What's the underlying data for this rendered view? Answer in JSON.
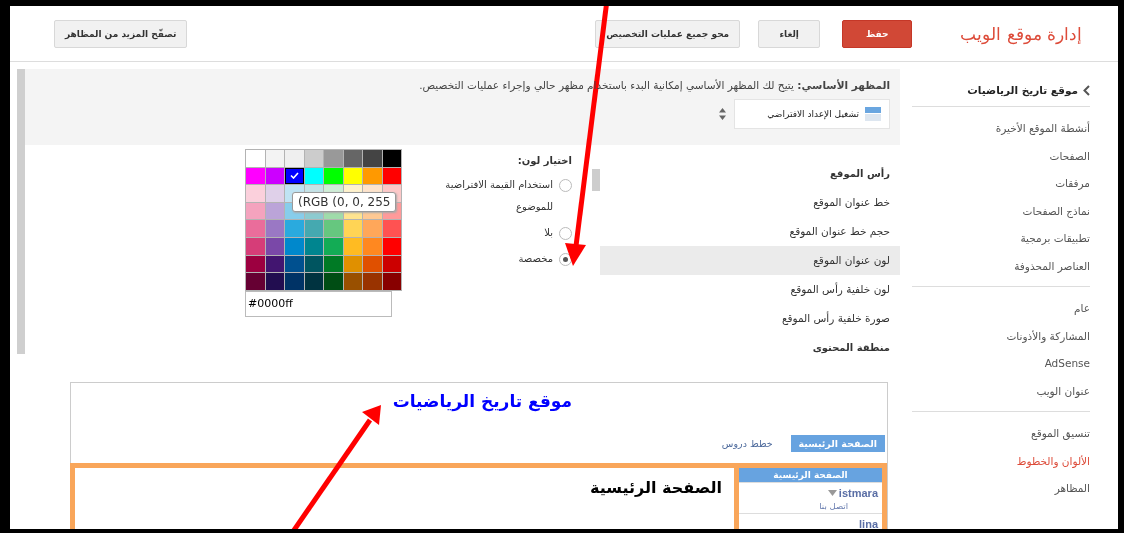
{
  "header": {
    "title": "إدارة موقع الويب",
    "buttons": [
      {
        "label": "حفظ",
        "kind": "primary"
      },
      {
        "label": "إلغاء",
        "kind": "plain"
      },
      {
        "label": "محو جميع عمليات التخصيص",
        "kind": "plain"
      },
      {
        "label": "تصفّح المزيد من المظاهر",
        "kind": "far"
      }
    ]
  },
  "sidebar": {
    "back": "موقع تاريخ الرياضيات",
    "groups": [
      {
        "items": [
          {
            "label": "أنشطة الموقع الأخيرة",
            "selected": false
          },
          {
            "label": "الصفحات",
            "selected": false
          },
          {
            "label": "مرفقات",
            "selected": false
          },
          {
            "label": "نماذج الصفحات",
            "selected": false
          },
          {
            "label": "تطبيقات برمجية",
            "selected": false
          },
          {
            "label": "العناصر المحذوفة",
            "selected": false
          }
        ]
      },
      {
        "items": [
          {
            "label": "عام",
            "selected": false
          },
          {
            "label": "المشاركة والأذونات",
            "selected": false
          },
          {
            "label": "AdSense",
            "selected": false
          },
          {
            "label": "عنوان الويب",
            "selected": false
          }
        ]
      },
      {
        "items": [
          {
            "label": "تنسيق الموقع",
            "selected": false
          },
          {
            "label": "الألوان والخطوط",
            "selected": true
          },
          {
            "label": "المظاهر",
            "selected": false
          }
        ]
      }
    ]
  },
  "theme_panel": {
    "description": "**المظهر الأساسي:** يتيح لك المظهر الأساسي إمكانية البدء باستخدام مظهر حالي وإجراء عمليات التخصيص.",
    "select_value": "تشغيل الإعداد الافتراضي"
  },
  "settings": {
    "items": [
      {
        "label": "رأس الموقع",
        "kind": "heading",
        "selected": false
      },
      {
        "label": "خط عنوان الموقع",
        "kind": "item",
        "selected": false
      },
      {
        "label": "حجم خط عنوان الموقع",
        "kind": "item",
        "selected": false
      },
      {
        "label": "لون عنوان الموقع",
        "kind": "item",
        "selected": true
      },
      {
        "label": "لون خلفية رأس الموقع",
        "kind": "item",
        "selected": false
      },
      {
        "label": "صورة خلفية رأس الموقع",
        "kind": "item",
        "selected": false
      },
      {
        "label": "منطقة المحتوى",
        "kind": "heading",
        "selected": false
      }
    ]
  },
  "color_choice": {
    "label": "اختيار لون:",
    "options": [
      {
        "label": "استخدام القيمة الافتراضية للموضوع",
        "selected": false
      },
      {
        "label": "بلا",
        "selected": false
      },
      {
        "label": "مخصصة",
        "selected": true
      }
    ],
    "palette": [
      [
        {
          "color": "#ffffff",
          "selected": false
        },
        {
          "color": "#f3f3f3",
          "selected": false
        },
        {
          "color": "#efefef",
          "selected": false
        },
        {
          "color": "#cccccc",
          "selected": false
        },
        {
          "color": "#999999",
          "selected": false
        },
        {
          "color": "#666666",
          "selected": false
        },
        {
          "color": "#444444",
          "selected": false
        },
        {
          "color": "#000000",
          "selected": false
        }
      ],
      [
        {
          "color": "#ff00ff",
          "selected": false
        },
        {
          "color": "#cc00ff",
          "selected": false
        },
        {
          "color": "#0000ff",
          "selected": true
        },
        {
          "color": "#00ffff",
          "selected": false
        },
        {
          "color": "#00ff00",
          "selected": false
        },
        {
          "color": "#ffff00",
          "selected": false
        },
        {
          "color": "#ff9900",
          "selected": false
        },
        {
          "color": "#ff0000",
          "selected": false
        }
      ],
      [
        {
          "color": "#fbd0dc",
          "selected": false
        },
        {
          "color": "#dfd0e9",
          "selected": false
        },
        {
          "color": "#bfe3f3",
          "selected": false
        },
        {
          "color": "#c4e2e6",
          "selected": false
        },
        {
          "color": "#cfedd6",
          "selected": false
        },
        {
          "color": "#fff2cc",
          "selected": false
        },
        {
          "color": "#fde3cc",
          "selected": false
        },
        {
          "color": "#fcc8c8",
          "selected": false
        }
      ],
      [
        {
          "color": "#f4a3be",
          "selected": false
        },
        {
          "color": "#bba4d8",
          "selected": false
        },
        {
          "color": "#87cdeb",
          "selected": false
        },
        {
          "color": "#8ccbd0",
          "selected": false
        },
        {
          "color": "#9fdcaa",
          "selected": false
        },
        {
          "color": "#ffe48f",
          "selected": false
        },
        {
          "color": "#ffc993",
          "selected": false
        },
        {
          "color": "#ff9a9a",
          "selected": false
        }
      ],
      [
        {
          "color": "#ea6d9b",
          "selected": false
        },
        {
          "color": "#9a78c4",
          "selected": false
        },
        {
          "color": "#2aaade",
          "selected": false
        },
        {
          "color": "#45a9b0",
          "selected": false
        },
        {
          "color": "#66c77f",
          "selected": false
        },
        {
          "color": "#ffd455",
          "selected": false
        },
        {
          "color": "#ffa75a",
          "selected": false
        },
        {
          "color": "#ff5252",
          "selected": false
        }
      ],
      [
        {
          "color": "#d63d78",
          "selected": false
        },
        {
          "color": "#7a48a8",
          "selected": false
        },
        {
          "color": "#0088cc",
          "selected": false
        },
        {
          "color": "#00858f",
          "selected": false
        },
        {
          "color": "#13ac55",
          "selected": false
        },
        {
          "color": "#ffbb22",
          "selected": false
        },
        {
          "color": "#ff8820",
          "selected": false
        },
        {
          "color": "#ff0000",
          "selected": false
        }
      ],
      [
        {
          "color": "#9c0040",
          "selected": false
        },
        {
          "color": "#421570",
          "selected": false
        },
        {
          "color": "#00508f",
          "selected": false
        },
        {
          "color": "#005560",
          "selected": false
        },
        {
          "color": "#007a25",
          "selected": false
        },
        {
          "color": "#e09000",
          "selected": false
        },
        {
          "color": "#e05000",
          "selected": false
        },
        {
          "color": "#cc0000",
          "selected": false
        }
      ],
      [
        {
          "color": "#660033",
          "selected": false
        },
        {
          "color": "#220d50",
          "selected": false
        },
        {
          "color": "#003366",
          "selected": false
        },
        {
          "color": "#003340",
          "selected": false
        },
        {
          "color": "#004d14",
          "selected": false
        },
        {
          "color": "#995000",
          "selected": false
        },
        {
          "color": "#993300",
          "selected": false
        },
        {
          "color": "#880000",
          "selected": false
        }
      ]
    ],
    "tooltip": "(RGB (0, 0, 255",
    "hex_value": "#0000ff"
  },
  "preview": {
    "site_title": "موقع تاريخ الرياضيات",
    "nav": [
      {
        "label": "الصفحة الرئيسية",
        "selected": true
      },
      {
        "label": "خطط دروس",
        "selected": false
      }
    ],
    "side_nav": {
      "title": "الصفحة الرئيسية",
      "items": [
        {
          "label": "istmara",
          "children": [
            {
              "label": "اتصل بنا"
            }
          ]
        },
        {
          "label": "lina"
        }
      ]
    },
    "page_heading": "الصفحة الرئيسية"
  }
}
